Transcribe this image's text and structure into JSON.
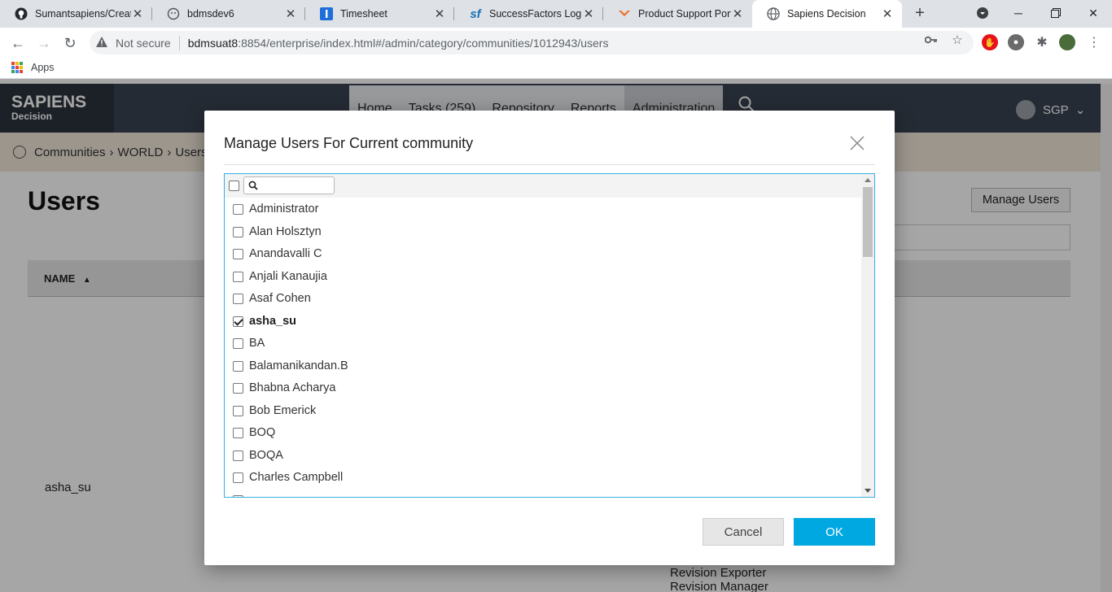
{
  "browser": {
    "tabs": [
      {
        "title": "Sumantsapiens/Create",
        "icon": "github-icon"
      },
      {
        "title": "bdmsdev6",
        "icon": "ghost-icon"
      },
      {
        "title": "Timesheet",
        "icon": "timesheet-icon"
      },
      {
        "title": "SuccessFactors Log in",
        "icon": "successfactors-icon"
      },
      {
        "title": "Product Support Porta",
        "icon": "support-portal-icon"
      },
      {
        "title": "Sapiens Decision",
        "icon": "globe-icon"
      }
    ],
    "address": {
      "security_label": "Not secure",
      "host": "bdmsuat8",
      "path": ":8854/enterprise/index.html#/admin/category/communities/1012943/users"
    },
    "bookmarks": {
      "apps_label": "Apps"
    }
  },
  "app": {
    "logo": {
      "main": "SAPIENS",
      "sub": "Decision"
    },
    "nav": [
      "Home",
      "Tasks (259)",
      "Repository",
      "Reports",
      "Administration"
    ],
    "user_code": "SGP",
    "breadcrumb": [
      "Communities",
      "WORLD",
      "Users"
    ],
    "page_title": "Users",
    "manage_users_label": "Manage Users",
    "table": {
      "column_name": "NAME"
    },
    "row_name": "asha_su",
    "roles": [
      "Revision Exporter",
      "Revision Manager"
    ]
  },
  "modal": {
    "title": "Manage Users For Current community",
    "search_placeholder": "",
    "users": [
      {
        "name": "Administrator",
        "checked": false
      },
      {
        "name": "Alan Holsztyn",
        "checked": false
      },
      {
        "name": "Anandavalli C",
        "checked": false
      },
      {
        "name": "Anjali Kanaujia",
        "checked": false
      },
      {
        "name": "Asaf Cohen",
        "checked": false
      },
      {
        "name": "asha_su",
        "checked": true
      },
      {
        "name": "BA",
        "checked": false
      },
      {
        "name": "Balamanikandan.B",
        "checked": false
      },
      {
        "name": "Bhabna Acharya",
        "checked": false
      },
      {
        "name": "Bob Emerick",
        "checked": false
      },
      {
        "name": "BOQ",
        "checked": false
      },
      {
        "name": "BOQA",
        "checked": false
      },
      {
        "name": "Charles Campbell",
        "checked": false
      }
    ],
    "cancel_label": "Cancel",
    "ok_label": "OK"
  },
  "colors": {
    "accent": "#00a8e1",
    "header": "#3a4350",
    "breadcrumb_bg": "#f0e6d9",
    "list_border": "#36b0e0"
  }
}
